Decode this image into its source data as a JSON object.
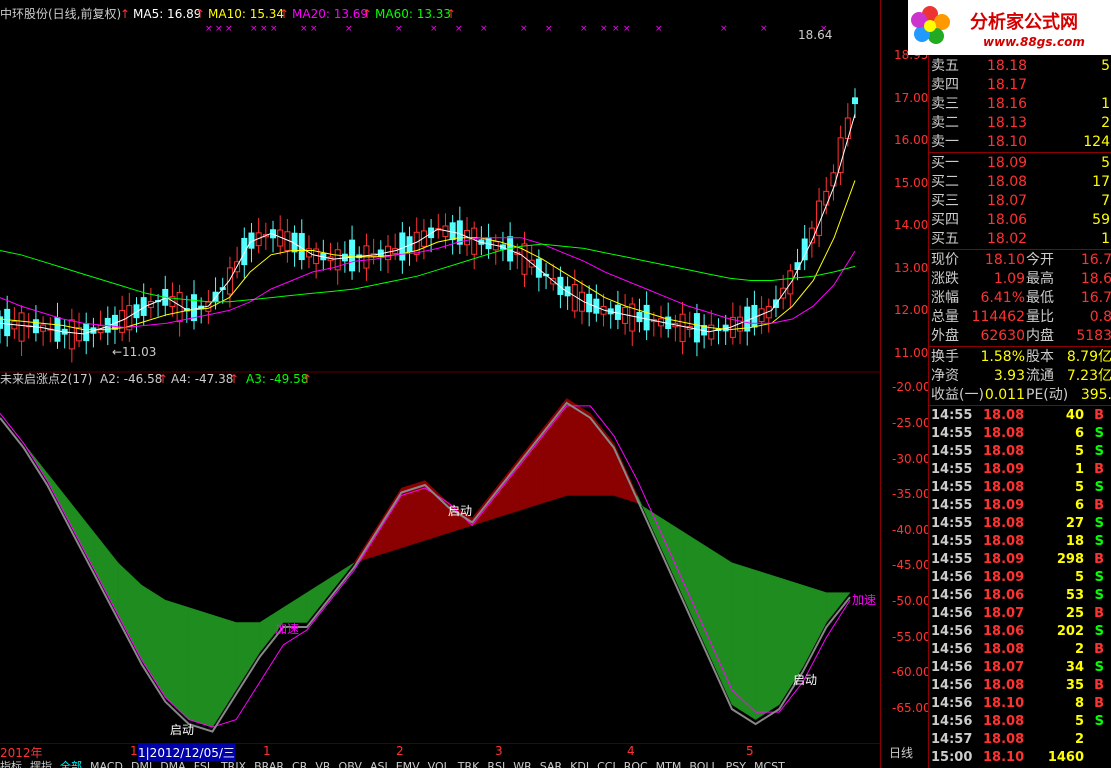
{
  "header": {
    "stock": "中环股份(日线,前复权)",
    "ma5_label": "MA5: 16.89",
    "ma10_label": "MA10: 15.34",
    "ma20_label": "MA20: 13.69",
    "ma60_label": "MA60: 13.33",
    "high_mark": "18.64",
    "low_mark": "11.03",
    "colors": {
      "ma5": "#ffffff",
      "ma10": "#ffff00",
      "ma20": "#ff00ff",
      "ma60": "#00ff00",
      "up": "#ff3232",
      "down": "#54ffff"
    }
  },
  "indicator": {
    "name": "未来启涨点2(17)",
    "a2_label": "A2: -46.58",
    "a4_label": "A4: -47.38",
    "a3_label": "A3: -49.58",
    "annotations": [
      "启动",
      "加速",
      "启动",
      "加速",
      "启动"
    ]
  },
  "price_axis": {
    "labels": [
      "18.95",
      "17.00",
      "16.00",
      "15.00",
      "14.00",
      "13.00",
      "12.00",
      "11.00"
    ]
  },
  "ind_axis": {
    "labels": [
      "-20.00",
      "-25.00",
      "-30.00",
      "-35.00",
      "-40.00",
      "-45.00",
      "-50.00",
      "-55.00",
      "-60.00",
      "-65.00"
    ]
  },
  "time_axis": {
    "labels": [
      "2012年",
      "1",
      "2",
      "3",
      "4",
      "5"
    ],
    "cursor": "1|2012/12/05/三",
    "period": "日线"
  },
  "bottom_tabs": [
    "指标",
    "摆指",
    "全部",
    "MACD",
    "DMI",
    "DMA",
    "FSL",
    "TRIX",
    "BRAR",
    "CR",
    "VR",
    "OBV",
    "ASI",
    "EMV",
    "VOL",
    "TRK",
    "RSI",
    "WR",
    "SAR",
    "KDJ",
    "CCI",
    "ROC",
    "MTM",
    "BOLL",
    "PSY",
    "MCST"
  ],
  "logo": {
    "title": "分析家公式网",
    "url": "www.88gs.com"
  },
  "order_book": {
    "sell": [
      {
        "label": "卖五",
        "price": "18.18",
        "vol": "5"
      },
      {
        "label": "卖四",
        "price": "18.17",
        "vol": ""
      },
      {
        "label": "卖三",
        "price": "18.16",
        "vol": "1"
      },
      {
        "label": "卖二",
        "price": "18.13",
        "vol": "2"
      },
      {
        "label": "卖一",
        "price": "18.10",
        "vol": "124"
      }
    ],
    "buy": [
      {
        "label": "买一",
        "price": "18.09",
        "vol": "5"
      },
      {
        "label": "买二",
        "price": "18.08",
        "vol": "17"
      },
      {
        "label": "买三",
        "price": "18.07",
        "vol": "7"
      },
      {
        "label": "买四",
        "price": "18.06",
        "vol": "59"
      },
      {
        "label": "买五",
        "price": "18.02",
        "vol": "1"
      }
    ]
  },
  "quote": [
    {
      "l1": "现价",
      "v1": "18.10",
      "l2": "今开",
      "v2": "16.7"
    },
    {
      "l1": "涨跌",
      "v1": "1.09",
      "l2": "最高",
      "v2": "18.6"
    },
    {
      "l1": "涨幅",
      "v1": "6.41%",
      "l2": "最低",
      "v2": "16.7"
    },
    {
      "l1": "总量",
      "v1": "114462",
      "l2": "量比",
      "v2": "0.8"
    },
    {
      "l1": "外盘",
      "v1": "62630",
      "l2": "内盘",
      "v2": "5183"
    }
  ],
  "stats": [
    {
      "l1": "换手",
      "v1": "1.58%",
      "l2": "股本",
      "v2": "8.79亿"
    },
    {
      "l1": "净资",
      "v1": "3.93",
      "l2": "流通",
      "v2": "7.23亿"
    },
    {
      "l1": "收益(一)",
      "v1": "0.011",
      "l2": "PE(动)",
      "v2": "395."
    }
  ],
  "trades": [
    {
      "time": "14:55",
      "price": "18.08",
      "vol": "40",
      "side": "B"
    },
    {
      "time": "14:55",
      "price": "18.08",
      "vol": "6",
      "side": "S"
    },
    {
      "time": "14:55",
      "price": "18.08",
      "vol": "5",
      "side": "S"
    },
    {
      "time": "14:55",
      "price": "18.09",
      "vol": "1",
      "side": "B"
    },
    {
      "time": "14:55",
      "price": "18.08",
      "vol": "5",
      "side": "S"
    },
    {
      "time": "14:55",
      "price": "18.09",
      "vol": "6",
      "side": "B"
    },
    {
      "time": "14:55",
      "price": "18.08",
      "vol": "27",
      "side": "S"
    },
    {
      "time": "14:55",
      "price": "18.08",
      "vol": "18",
      "side": "S"
    },
    {
      "time": "14:55",
      "price": "18.09",
      "vol": "298",
      "side": "B"
    },
    {
      "time": "14:56",
      "price": "18.09",
      "vol": "5",
      "side": "S"
    },
    {
      "time": "14:56",
      "price": "18.06",
      "vol": "53",
      "side": "S"
    },
    {
      "time": "14:56",
      "price": "18.07",
      "vol": "25",
      "side": "B"
    },
    {
      "time": "14:56",
      "price": "18.06",
      "vol": "202",
      "side": "S"
    },
    {
      "time": "14:56",
      "price": "18.08",
      "vol": "2",
      "side": "B"
    },
    {
      "time": "14:56",
      "price": "18.07",
      "vol": "34",
      "side": "S"
    },
    {
      "time": "14:56",
      "price": "18.08",
      "vol": "35",
      "side": "B"
    },
    {
      "time": "14:56",
      "price": "18.10",
      "vol": "8",
      "side": "B"
    },
    {
      "time": "14:56",
      "price": "18.08",
      "vol": "5",
      "side": "S"
    },
    {
      "time": "14:57",
      "price": "18.08",
      "vol": "2",
      "side": ""
    },
    {
      "time": "15:00",
      "price": "18.10",
      "vol": "1460",
      "side": ""
    }
  ],
  "chart_data": [
    {
      "type": "line",
      "title": "中环股份(日线,前复权)",
      "ylim": [
        11.0,
        18.95
      ],
      "series": [
        {
          "name": "MA5",
          "values": [
            12.0,
            11.95,
            11.9,
            11.8,
            11.75,
            11.9,
            12.1,
            12.4,
            12.6,
            12.3,
            12.4,
            13.0,
            13.9,
            14.1,
            13.9,
            13.6,
            13.5,
            13.55,
            13.6,
            13.7,
            13.9,
            14.2,
            14.1,
            13.9,
            13.8,
            13.6,
            13.2,
            12.8,
            12.5,
            12.3,
            12.2,
            12.1,
            12.0,
            11.9,
            11.8,
            11.9,
            12.1,
            12.3,
            13.0,
            14.0,
            15.2,
            16.89
          ]
        },
        {
          "name": "MA10",
          "values": [
            12.1,
            12.05,
            12.0,
            11.95,
            11.85,
            11.85,
            11.9,
            12.05,
            12.2,
            12.3,
            12.35,
            12.6,
            13.2,
            13.6,
            13.7,
            13.7,
            13.6,
            13.55,
            13.55,
            13.6,
            13.7,
            13.9,
            14.0,
            14.0,
            13.9,
            13.75,
            13.5,
            13.2,
            12.9,
            12.6,
            12.4,
            12.25,
            12.1,
            12.0,
            11.9,
            11.85,
            11.9,
            12.0,
            12.4,
            13.0,
            14.0,
            15.34
          ]
        },
        {
          "name": "MA20",
          "values": [
            12.6,
            12.4,
            12.25,
            12.1,
            12.0,
            11.95,
            11.9,
            11.95,
            12.0,
            12.1,
            12.2,
            12.3,
            12.5,
            12.8,
            13.0,
            13.2,
            13.3,
            13.45,
            13.5,
            13.6,
            13.65,
            13.75,
            13.9,
            14.0,
            14.0,
            14.0,
            13.85,
            13.65,
            13.45,
            13.2,
            13.0,
            12.8,
            12.6,
            12.4,
            12.25,
            12.1,
            12.0,
            12.0,
            12.1,
            12.4,
            12.9,
            13.69
          ]
        },
        {
          "name": "MA60",
          "values": [
            13.7,
            13.6,
            13.45,
            13.3,
            13.15,
            13.0,
            12.85,
            12.7,
            12.6,
            12.55,
            12.5,
            12.5,
            12.55,
            12.6,
            12.65,
            12.7,
            12.75,
            12.8,
            12.9,
            13.0,
            13.1,
            13.25,
            13.4,
            13.55,
            13.7,
            13.8,
            13.85,
            13.8,
            13.75,
            13.65,
            13.55,
            13.45,
            13.35,
            13.25,
            13.15,
            13.05,
            13.0,
            13.0,
            13.05,
            13.1,
            13.2,
            13.33
          ]
        }
      ]
    },
    {
      "type": "area",
      "title": "未来启涨点2(17)",
      "ylim": [
        -67,
        -18
      ],
      "series": [
        {
          "name": "A2",
          "values": [
            -23,
            -27,
            -32,
            -38,
            -44,
            -50,
            -56,
            -61,
            -64,
            -65,
            -60,
            -55,
            -51,
            -51,
            -47,
            -43,
            -38,
            -33,
            -32,
            -35,
            -37,
            -33,
            -29,
            -25,
            -21,
            -23,
            -27,
            -34,
            -41,
            -48,
            -55,
            -62,
            -64,
            -62,
            -57,
            -51,
            -47
          ]
        },
        {
          "name": "A4",
          "values": [
            -23,
            -27,
            -31,
            -35,
            -39,
            -43,
            -46,
            -48,
            -49,
            -50,
            -51,
            -51,
            -49,
            -47,
            -45,
            -43,
            -42,
            -41,
            -40,
            -39,
            -38,
            -37,
            -36,
            -35,
            -34,
            -34,
            -34,
            -35,
            -37,
            -39,
            -41,
            -43,
            -44,
            -45,
            -46,
            -47,
            -47
          ]
        },
        {
          "name": "A3",
          "values": [
            -23,
            -27,
            -32,
            -38,
            -44,
            -50,
            -56,
            -61,
            -64,
            -65,
            -64,
            -59,
            -54,
            -52,
            -48,
            -44,
            -39,
            -34,
            -33,
            -35,
            -38,
            -34,
            -30,
            -26,
            -22,
            -22,
            -26,
            -32,
            -39,
            -46,
            -53,
            -60,
            -63,
            -63,
            -59,
            -53,
            -48
          ]
        }
      ]
    }
  ]
}
